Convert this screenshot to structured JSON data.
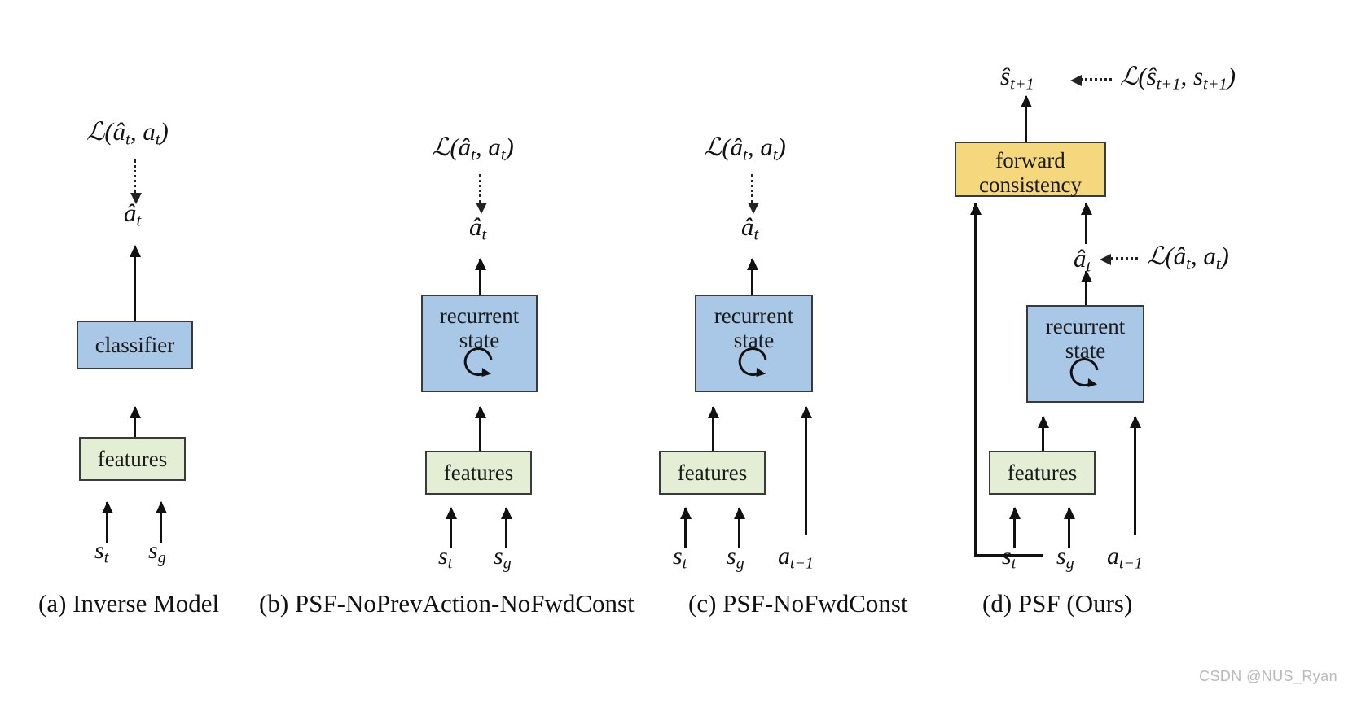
{
  "figure": {
    "watermark": "CSDN @NUS_Ryan",
    "colors": {
      "blue_box": "#a9c7e6",
      "green_box": "#e3eed4",
      "yellow_box": "#f5d77e",
      "box_border": "#3a3a3a",
      "arrow": "#111111",
      "watermark": "#b9b9b9",
      "background": "#ffffff"
    }
  },
  "panels": [
    {
      "id": "a",
      "caption": "(a) Inverse Model",
      "loss_label": "ℒ(â_t, a_t)",
      "output_label": "â_t",
      "boxes": [
        {
          "name": "classifier",
          "label": "classifier",
          "color": "blue"
        },
        {
          "name": "features",
          "label": "features",
          "color": "green"
        }
      ],
      "inputs": [
        "s_t",
        "s_g"
      ]
    },
    {
      "id": "b",
      "caption": "(b) PSF-NoPrevAction-NoFwdConst",
      "loss_label": "ℒ(â_t, a_t)",
      "output_label": "â_t",
      "boxes": [
        {
          "name": "recurrent-state",
          "label": "recurrent state",
          "color": "blue",
          "has_loop": true
        },
        {
          "name": "features",
          "label": "features",
          "color": "green"
        }
      ],
      "inputs": [
        "s_t",
        "s_g"
      ]
    },
    {
      "id": "c",
      "caption": "(c) PSF-NoFwdConst",
      "loss_label": "ℒ(â_t, a_t)",
      "output_label": "â_t",
      "boxes": [
        {
          "name": "recurrent-state",
          "label": "recurrent state",
          "color": "blue",
          "has_loop": true
        },
        {
          "name": "features",
          "label": "features",
          "color": "green"
        }
      ],
      "inputs": [
        "s_t",
        "s_g",
        "a_t-1"
      ]
    },
    {
      "id": "d",
      "caption": "(d) PSF (Ours)",
      "state_output_label": "ŝ_t+1",
      "state_loss_label": "ℒ(ŝ_t+1, s_t+1)",
      "action_output_label": "â_t",
      "action_loss_label": "ℒ(â_t, a_t)",
      "boxes": [
        {
          "name": "forward-consistency",
          "label": "forward consistency",
          "color": "yellow"
        },
        {
          "name": "recurrent-state",
          "label": "recurrent state",
          "color": "blue",
          "has_loop": true
        },
        {
          "name": "features",
          "label": "features",
          "color": "green"
        }
      ],
      "inputs": [
        "s_t",
        "s_g",
        "a_t-1"
      ]
    }
  ],
  "labels": {
    "classifier": "classifier",
    "features": "features",
    "recurrent_line1": "recurrent",
    "recurrent_line2": "state",
    "forward_line1": "forward",
    "forward_line2": "consistency",
    "caption_a": "(a) Inverse Model",
    "caption_b": "(b) PSF-NoPrevAction-NoFwdConst",
    "caption_c": "(c) PSF-NoFwdConst",
    "caption_d": "(d) PSF (Ours)",
    "watermark": "CSDN @NUS_Ryan"
  }
}
